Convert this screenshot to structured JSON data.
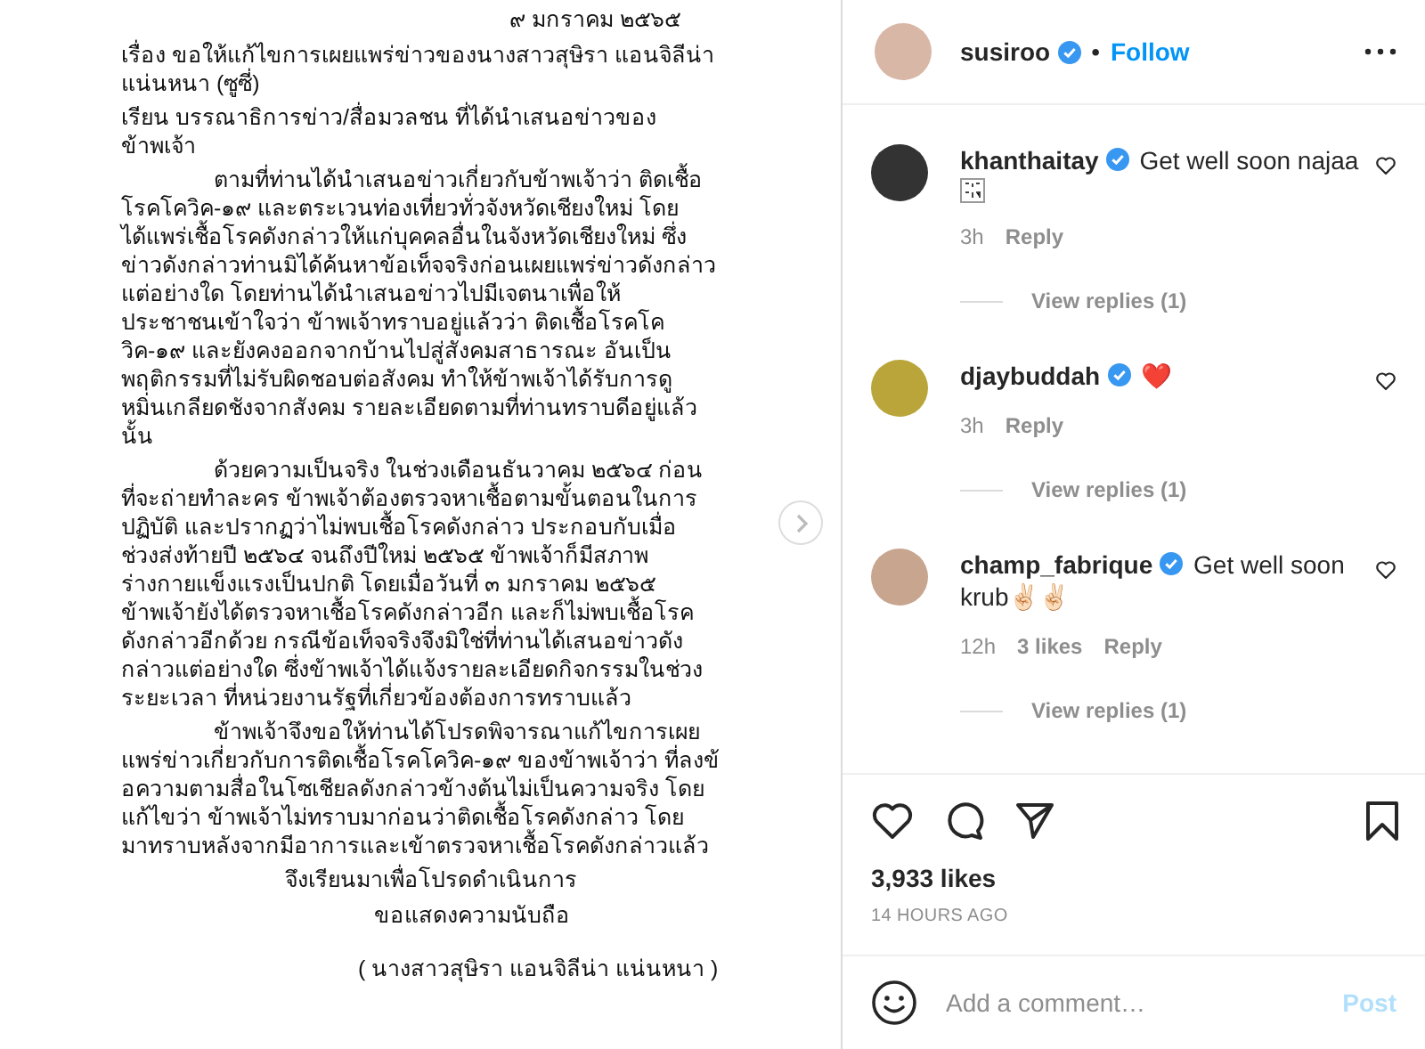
{
  "letter": {
    "date": "๙ มกราคม ๒๕๖๕",
    "paragraphs": [
      {
        "kind": "heading",
        "lines": [
          "เรื่อง  ขอให้แก้ไขการเผยแพร่ข่าวของนางสาวสุษิรา แอนจิลีน่า",
          "แน่นหนา (ซูซี่)"
        ]
      },
      {
        "kind": "heading",
        "lines": [
          "เรียน  บรรณาธิการข่าว/สื่อมวลชน ที่ได้นำเสนอข่าวของ",
          "ข้าพเจ้า"
        ]
      },
      {
        "kind": "body",
        "lines": [
          "ตามที่ท่านได้นำเสนอข่าวเกี่ยวกับข้าพเจ้าว่า ติดเชื้อ",
          "โรคโควิค-๑๙ และตระเวนท่องเที่ยวทั่วจังหวัดเชียงใหม่  โดย",
          "ได้แพร่เชื้อโรคดังกล่าวให้แก่บุคคลอื่นในจังหวัดเชียงใหม่  ซึ่ง",
          "ข่าวดังกล่าวท่านมิได้ค้นหาข้อเท็จจริงก่อนเผยแพร่ข่าวดังกล่าว",
          "แต่อย่างใด  โดยท่านได้นำเสนอข่าวไปมีเจตนาเพื่อให้",
          "ประชาชนเข้าใจว่า ข้าพเจ้าทราบอยู่แล้วว่า ติดเชื้อโรคโค",
          "วิค-๑๙ และยังคงออกจากบ้านไปสู่สังคมสาธารณะ อันเป็น",
          "พฤติกรรมที่ไม่รับผิดชอบต่อสังคม ทำให้ข้าพเจ้าได้รับการดู",
          "หมิ่นเกลียดชังจากสังคม รายละเอียดตามที่ท่านทราบดีอยู่แล้ว",
          "นั้น"
        ]
      },
      {
        "kind": "body",
        "lines": [
          "ด้วยความเป็นจริง ในช่วงเดือนธันวาคม ๒๕๖๔ ก่อน",
          "ที่จะถ่ายทำละคร ข้าพเจ้าต้องตรวจหาเชื้อตามขั้นตอนในการ",
          "ปฏิบัติ และปรากฏว่าไม่พบเชื้อโรคดังกล่าว  ประกอบกับเมื่อ",
          "ช่วงส่งท้ายปี ๒๕๖๔ จนถึงปีใหม่ ๒๕๖๕  ข้าพเจ้าก็มีสภาพ",
          "ร่างกายแข็งแรงเป็นปกติ โดยเมื่อวันที่ ๓ มกราคม ๒๕๖๕",
          "ข้าพเจ้ายังได้ตรวจหาเชื้อโรคดังกล่าวอีก และก็ไม่พบเชื้อโรค",
          "ดังกล่าวอีกด้วย  กรณีข้อเท็จจริงจึงมิใช่ที่ท่านได้เสนอข่าวดัง",
          "กล่าวแต่อย่างใด  ซึ่งข้าพเจ้าได้แจ้งรายละเอียดกิจกรรมในช่วง",
          "ระยะเวลา ที่หน่วยงานรัฐที่เกี่ยวข้องต้องการทราบแล้ว"
        ]
      },
      {
        "kind": "body",
        "lines": [
          "ข้าพเจ้าจึงขอให้ท่านได้โปรดพิจารณาแก้ไขการเผย",
          "แพร่ข่าวเกี่ยวกับการติดเชื้อโรคโควิค-๑๙ ของข้าพเจ้าว่า ที่ลงข้",
          "อความตามสื่อในโซเชียลดังกล่าวข้างต้นไม่เป็นความจริง โดย",
          "แก้ไขว่า ข้าพเจ้าไม่ทราบมาก่อนว่าติดเชื้อโรคดังกล่าว  โดย",
          "มาทราบหลังจากมีอาการและเข้าตรวจหาเชื้อโรคดังกล่าวแล้ว"
        ]
      }
    ],
    "closing": "จึงเรียนมาเพื่อโปรดดำเนินการ",
    "regards": "ขอแสดงความนับถือ",
    "signature": "( นางสาวสุษิรา แอนจิลีน่า แน่นหนา )"
  },
  "header": {
    "username": "susiroo",
    "verified": true,
    "separator": "•",
    "follow": "Follow"
  },
  "comments": [
    {
      "username": "khanthaitay",
      "verified": true,
      "text": "Get well soon najaa",
      "sticker": true,
      "time": "3h",
      "reply": "Reply",
      "view_replies": "View replies (1)"
    },
    {
      "username": "djaybuddah",
      "verified": true,
      "text": "❤️",
      "sticker": false,
      "time": "3h",
      "reply": "Reply",
      "view_replies": "View replies (1)"
    },
    {
      "username": "champ_fabrique",
      "verified": true,
      "text": "Get well soon krub✌🏻✌🏻",
      "sticker": false,
      "time": "12h",
      "likes": "3 likes",
      "reply": "Reply",
      "view_replies": "View replies (1)"
    }
  ],
  "likes": "3,933 likes",
  "timestamp": "14 HOURS AGO",
  "comment_box": {
    "placeholder": "Add a comment…",
    "post": "Post",
    "post_disabled": true
  }
}
